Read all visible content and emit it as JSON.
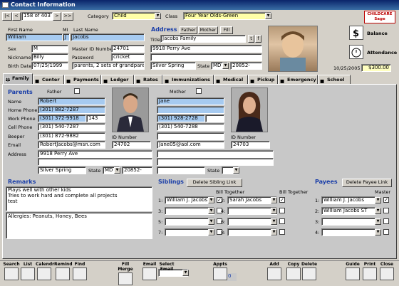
{
  "title": "Contact Information",
  "nav": {
    "first": "|<",
    "prev": "<",
    "record": "158 of 403",
    "next": ">",
    "last": ">>"
  },
  "category": {
    "label": "Category",
    "value": "Child"
  },
  "class": {
    "label": "Class",
    "value": "Four Year Olds-Green"
  },
  "logo": "CHILDCARE Sage",
  "person": {
    "first_name_label": "First Name",
    "mi_label": "MI",
    "last_name_label": "Last Name",
    "first_name": "William",
    "mi": "J",
    "last_name": "Jacobs",
    "sex_label": "Sex",
    "sex": "M",
    "master_id_label": "Master ID Number",
    "master_id": "24701",
    "nickname_label": "Nickname",
    "nickname": "Billy",
    "password_label": "Password",
    "password": "cricket",
    "birth_date_label": "Birth Date",
    "birth_date": "07/25/1999",
    "lives_with": "parents, 2 sets of grandparen"
  },
  "address": {
    "label": "Address",
    "father_btn": "Father",
    "mother_btn": "Mother",
    "fill_btn": "Fill",
    "title_label": "Title",
    "title": "Jacobs Family",
    "t_btn": "t",
    "f_btn": "f",
    "line1": "9918 Perry Ave",
    "line2": "",
    "city": "Silver Spring",
    "state_label": "State",
    "state": "MD",
    "zip": "20852-"
  },
  "side": {
    "balance_label": "Balance",
    "attendance_label": "Attendance",
    "date": "10/25/2005",
    "amount": "$300.00"
  },
  "tabs": [
    "Family",
    "Center",
    "Payments",
    "Ledger",
    "Rates",
    "Immunizations",
    "Medical",
    "Pickup",
    "Emergency",
    "School"
  ],
  "parents": {
    "label": "Parents",
    "father_label": "Father",
    "mother_label": "Mother",
    "row_labels": [
      "Name",
      "Home Phone",
      "Work Phone",
      "Cell Phone",
      "Beeper",
      "Email",
      "Address"
    ],
    "father": {
      "name": "Robert",
      "home": "(301) 882-7287",
      "work": "(301) 372-9918",
      "ext": "143",
      "cell": "(301) 540-7287",
      "beeper": "(301) 872-9882",
      "email": "RobertJacobs@msn.com",
      "addr1": "9918 Perry Ave",
      "city": "Silver Spring",
      "state": "MD",
      "zip": "20852-",
      "id_label": "ID Number",
      "id": "24702"
    },
    "mother": {
      "name": "Jane",
      "home": "",
      "work": "(301) 928-2728",
      "cell": "(301) 540-7288",
      "beeper": "",
      "email": "Jane05@aol.com",
      "id_label": "ID Number",
      "id": "24703",
      "state": ""
    }
  },
  "remarks": {
    "label": "Remarks",
    "text1": "Plays well with other kids",
    "text2": "Tries to work hard and complete all projects",
    "text3": "test",
    "allergies": "Allergies: Peanuts, Honey, Bees"
  },
  "siblings": {
    "label": "Siblings",
    "delete_btn": "Delete Sibling Link",
    "bill_together": "Bill Together",
    "rows": [
      {
        "n": "1:",
        "name": "William J. Jacobs"
      },
      {
        "n": "2:",
        "name": "Sarah Jacobs"
      },
      {
        "n": "3:",
        "name": ""
      },
      {
        "n": "4:",
        "name": ""
      },
      {
        "n": "5:",
        "name": ""
      },
      {
        "n": "6:",
        "name": ""
      },
      {
        "n": "7:",
        "name": ""
      },
      {
        "n": "8:",
        "name": ""
      }
    ]
  },
  "payees": {
    "label": "Payees",
    "delete_btn": "Delete Payee Link",
    "master_label": "Master",
    "rows": [
      {
        "n": "1:",
        "name": "William J. Jacobs"
      },
      {
        "n": "2:",
        "name": "William Jacobs ST"
      },
      {
        "n": "3:",
        "name": ""
      },
      {
        "n": "4:",
        "name": ""
      }
    ]
  },
  "toolbar": [
    "Search",
    "List",
    "Calendr",
    "Remind",
    "Find",
    "Fill Merge",
    "Email",
    "Select Email",
    "Appts",
    "Add",
    "Copy",
    "Delete",
    "Guide",
    "Print",
    "Close"
  ],
  "appts_count": "0"
}
